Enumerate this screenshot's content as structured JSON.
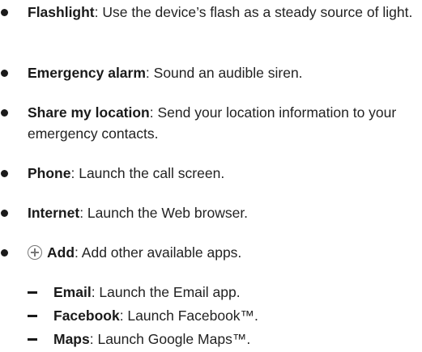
{
  "items": [
    {
      "term": "Flashlight",
      "desc": ": Use the device’s flash as a steady source of light."
    },
    {
      "term": "Emergency alarm",
      "desc": ": Sound an audible siren."
    },
    {
      "term": "Share my location",
      "desc": ": Send your location information to your emergency contacts."
    },
    {
      "term": "Phone",
      "desc": ": Launch the call screen."
    },
    {
      "term": "Internet",
      "desc": ": Launch the Web browser."
    },
    {
      "icon": "add-circle-icon",
      "term": "Add",
      "desc": ": Add other available apps."
    }
  ],
  "subitems": [
    {
      "term": "Email",
      "desc": ": Launch the Email app."
    },
    {
      "term": "Facebook",
      "desc": ": Launch Facebook™."
    },
    {
      "term": "Maps",
      "desc": ": Launch Google Maps™."
    }
  ]
}
